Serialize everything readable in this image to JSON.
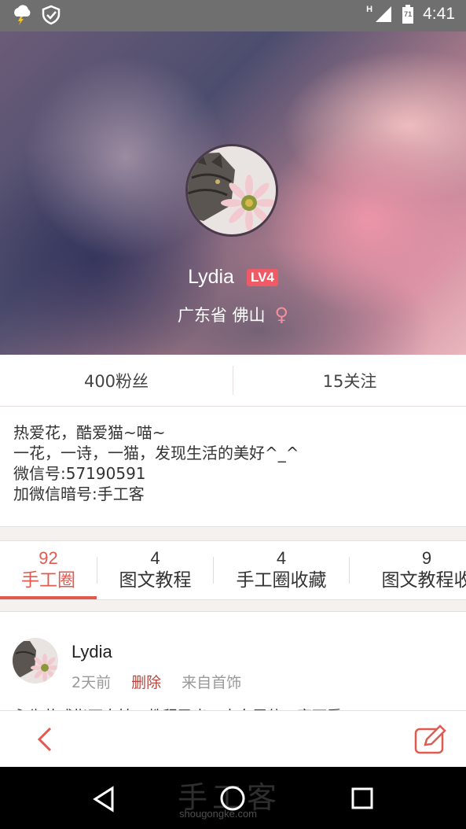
{
  "status_bar": {
    "time": "4:41",
    "network": "H",
    "battery": "71",
    "icons": [
      "weather-storm-icon",
      "shield-check-icon",
      "signal-icon",
      "battery-icon"
    ]
  },
  "profile": {
    "name": "Lydia",
    "level": "LV4",
    "location": "广东省 佛山",
    "gender_symbol": "♀"
  },
  "stats": {
    "fans": "400粉丝",
    "following": "15关注"
  },
  "bio": {
    "lines": [
      "热爱花，酷爱猫~喵~",
      "一花，一诗，一猫，发现生活的美好^_^",
      "微信号:57190591",
      "加微信暗号:手工客"
    ]
  },
  "tabs": [
    {
      "count": "92",
      "label": "手工圈",
      "active": true
    },
    {
      "count": "4",
      "label": "图文教程"
    },
    {
      "count": "4",
      "label": "手工圈收藏"
    },
    {
      "count": "9",
      "label": "图文教程收"
    }
  ],
  "post": {
    "author": "Lydia",
    "time": "2天前",
    "delete_label": "删除",
    "source": "来自首饰",
    "excerpt": "永生花戒指可自拍，教程已出，来向展使工客可看"
  },
  "watermark": {
    "text": "手工客",
    "url": "shougongke.com"
  },
  "colors": {
    "accent": "#e05a4f",
    "level_badge": "#f05a65",
    "gender": "#f38f9f"
  }
}
